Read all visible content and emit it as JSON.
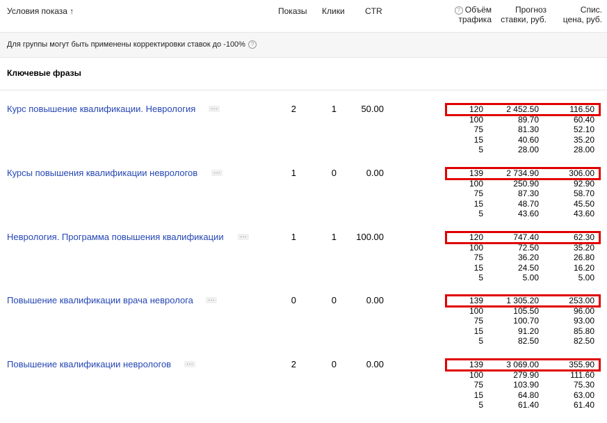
{
  "header": {
    "conditions": "Условия показа ↑",
    "shows": "Показы",
    "clicks": "Клики",
    "ctr": "CTR",
    "volume_line1": "Объём",
    "volume_line2": "трафика",
    "forecast_line1": "Прогноз",
    "forecast_line2": "ставки, руб.",
    "price_line1": "Спис.",
    "price_line2": "цена, руб."
  },
  "notice": {
    "text": "Для группы могут быть применены корректировки ставок до -100%"
  },
  "section": {
    "title": "Ключевые фразы"
  },
  "rows": [
    {
      "phrase": "Курс повышение квалификации. Неврология",
      "menu": "···",
      "shows": "2",
      "clicks": "1",
      "ctr": "50.00",
      "forecast": [
        [
          "120",
          "2 452.50",
          "116.50"
        ],
        [
          "100",
          "89.70",
          "60.40"
        ],
        [
          "75",
          "81.30",
          "52.10"
        ],
        [
          "15",
          "40.60",
          "35.20"
        ],
        [
          "5",
          "28.00",
          "28.00"
        ]
      ]
    },
    {
      "phrase": "Курсы повышения квалификации неврологов",
      "menu": "···",
      "shows": "1",
      "clicks": "0",
      "ctr": "0.00",
      "forecast": [
        [
          "139",
          "2 734.90",
          "306.00"
        ],
        [
          "100",
          "250.90",
          "92.90"
        ],
        [
          "75",
          "87.30",
          "58.70"
        ],
        [
          "15",
          "48.70",
          "45.50"
        ],
        [
          "5",
          "43.60",
          "43.60"
        ]
      ]
    },
    {
      "phrase": "Неврология. Программа повышения квалификации",
      "menu": "···",
      "shows": "1",
      "clicks": "1",
      "ctr": "100.00",
      "forecast": [
        [
          "120",
          "747.40",
          "62.30"
        ],
        [
          "100",
          "72.50",
          "35.20"
        ],
        [
          "75",
          "36.20",
          "26.80"
        ],
        [
          "15",
          "24.50",
          "16.20"
        ],
        [
          "5",
          "5.00",
          "5.00"
        ]
      ]
    },
    {
      "phrase": "Повышение квалификации врача невролога",
      "menu": "···",
      "shows": "0",
      "clicks": "0",
      "ctr": "0.00",
      "forecast": [
        [
          "139",
          "1 305.20",
          "253.00"
        ],
        [
          "100",
          "105.50",
          "96.00"
        ],
        [
          "75",
          "100.70",
          "93.00"
        ],
        [
          "15",
          "91.20",
          "85.80"
        ],
        [
          "5",
          "82.50",
          "82.50"
        ]
      ]
    },
    {
      "phrase": "Повышение квалификации неврологов",
      "menu": "···",
      "shows": "2",
      "clicks": "0",
      "ctr": "0.00",
      "forecast": [
        [
          "139",
          "3 069.00",
          "355.90"
        ],
        [
          "100",
          "279.90",
          "111.60"
        ],
        [
          "75",
          "103.90",
          "75.30"
        ],
        [
          "15",
          "64.80",
          "63.00"
        ],
        [
          "5",
          "61.40",
          "61.40"
        ]
      ]
    }
  ]
}
